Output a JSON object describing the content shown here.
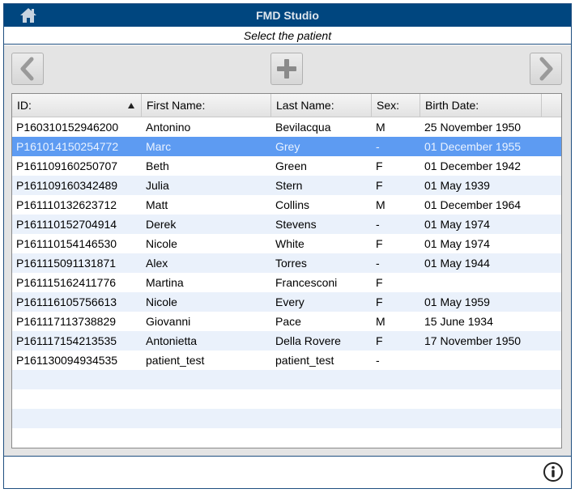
{
  "window": {
    "title": "FMD Studio",
    "subtitle": "Select the patient"
  },
  "icons": {
    "home": "home-icon",
    "prev": "chevron-left-icon",
    "add": "plus-icon",
    "next": "chevron-right-icon",
    "info": "info-icon",
    "sort": "sort-ascending-icon"
  },
  "colors": {
    "titlebar": "#00467f",
    "selected_row": "#5d9bf2",
    "alt_row": "#eaf1fb"
  },
  "table": {
    "columns": [
      "ID:",
      "First Name:",
      "Last Name:",
      "Sex:",
      "Birth Date:"
    ],
    "sorted_by": "ID:",
    "selected_index": 1,
    "rows": [
      {
        "id": "P160310152946200",
        "first": "Antonino",
        "last": "Bevilacqua",
        "sex": "M",
        "birth": "25 November 1950"
      },
      {
        "id": "P161014150254772",
        "first": "Marc",
        "last": "Grey",
        "sex": "-",
        "birth": "01 December 1955"
      },
      {
        "id": "P161109160250707",
        "first": "Beth",
        "last": "Green",
        "sex": "F",
        "birth": "01 December 1942"
      },
      {
        "id": "P161109160342489",
        "first": "Julia",
        "last": "Stern",
        "sex": "F",
        "birth": "01 May 1939"
      },
      {
        "id": "P161110132623712",
        "first": "Matt",
        "last": "Collins",
        "sex": "M",
        "birth": "01 December 1964"
      },
      {
        "id": "P161110152704914",
        "first": "Derek",
        "last": "Stevens",
        "sex": "-",
        "birth": "01 May 1974"
      },
      {
        "id": "P161110154146530",
        "first": "Nicole",
        "last": "White",
        "sex": "F",
        "birth": "01 May 1974"
      },
      {
        "id": "P161115091131871",
        "first": "Alex",
        "last": "Torres",
        "sex": "-",
        "birth": "01 May 1944"
      },
      {
        "id": "P161115162411776",
        "first": "Martina",
        "last": "Francesconi",
        "sex": "F",
        "birth": ""
      },
      {
        "id": "P161116105756613",
        "first": "Nicole",
        "last": "Every",
        "sex": "F",
        "birth": "01 May 1959"
      },
      {
        "id": "P161117113738829",
        "first": "Giovanni",
        "last": "Pace",
        "sex": "M",
        "birth": "15 June 1934"
      },
      {
        "id": "P161117154213535",
        "first": "Antonietta",
        "last": "Della Rovere",
        "sex": "F",
        "birth": "17 November 1950"
      },
      {
        "id": "P161130094934535",
        "first": "patient_test",
        "last": "patient_test",
        "sex": "-",
        "birth": ""
      }
    ]
  }
}
